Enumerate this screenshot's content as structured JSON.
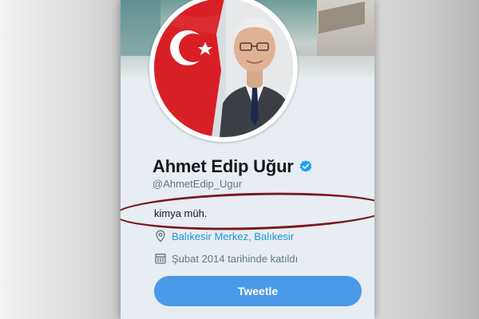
{
  "profile": {
    "name": "Ahmet Edip Uğur",
    "handle": "@AhmetEdip_Ugur",
    "bio": "kimya müh.",
    "location": "Balıkesir Merkez, Balıkesir",
    "joined": "Şubat 2014 tarihinde katıldı",
    "verified_icon": "verified-badge-icon"
  },
  "actions": {
    "tweet_label": "Tweetle"
  },
  "icons": {
    "location": "location-pin-icon",
    "calendar": "calendar-icon"
  },
  "colors": {
    "link_blue": "#1b95e0",
    "button_blue": "#4a99e9",
    "muted_text": "#657786",
    "highlight_ellipse": "#7a1820",
    "card_background": "#e7edf2"
  }
}
